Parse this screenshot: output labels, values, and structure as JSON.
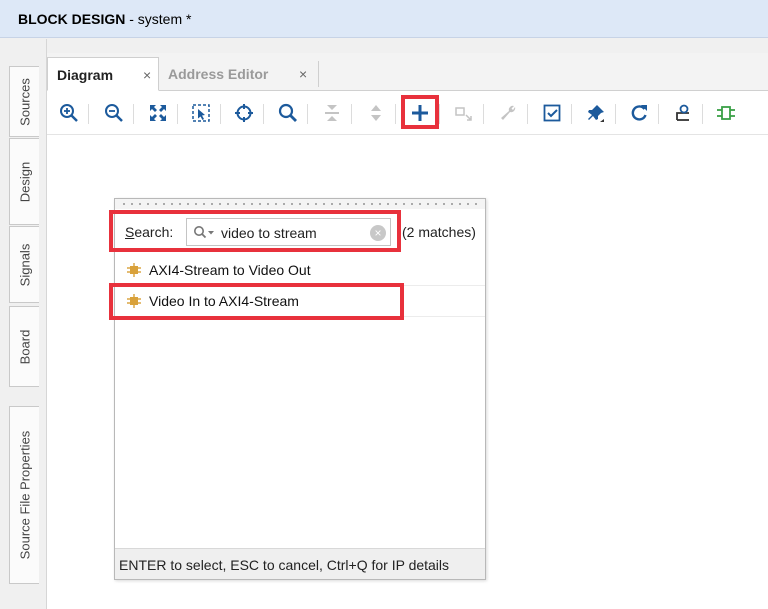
{
  "window": {
    "title_bold": "BLOCK DESIGN",
    "title_rest": " - system *"
  },
  "side_tabs": [
    {
      "label": "Sources"
    },
    {
      "label": "Design"
    },
    {
      "label": "Signals"
    },
    {
      "label": "Board"
    },
    {
      "label": "Source File Properties"
    }
  ],
  "tabs": [
    {
      "label": "Diagram",
      "close": "×",
      "active": true
    },
    {
      "label": "Address Editor",
      "close": "×",
      "active": false
    }
  ],
  "toolbar": {
    "icons": [
      "zoom-in-icon",
      "zoom-out-icon",
      "zoom-fit-icon",
      "zoom-selection-icon",
      "center-icon",
      "search-icon",
      "collapse-icon",
      "expand-icon",
      "add-ip-icon",
      "make-external-icon",
      "wrench-icon",
      "validate-icon",
      "pin-icon",
      "refresh-icon",
      "regenerate-layout-icon",
      "create-port-icon"
    ],
    "highlighted": "add-ip-icon"
  },
  "popup": {
    "search_label_prefix": "S",
    "search_label_rest": "earch:",
    "search_value": "video to stream",
    "matches": "(2 matches)",
    "results": [
      {
        "label": "AXI4-Stream to Video Out"
      },
      {
        "label": "Video In to AXI4-Stream"
      }
    ],
    "footer": "ENTER to select, ESC to cancel, Ctrl+Q for IP details"
  },
  "colors": {
    "highlight": "#e8313c",
    "title_bg": "#dde8f7",
    "accent_blue": "#1c5a9c",
    "ip_icon": "#d9a13a"
  }
}
